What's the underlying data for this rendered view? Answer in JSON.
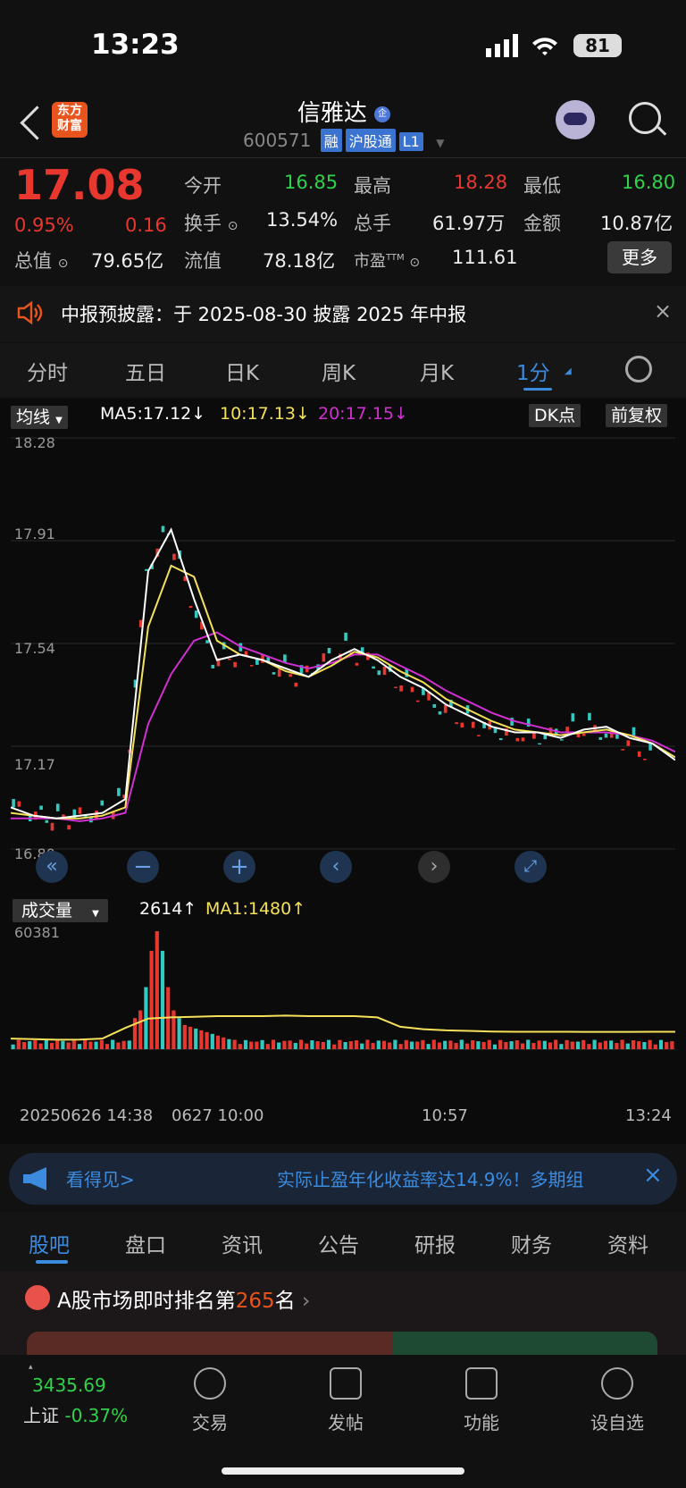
{
  "status_bar": {
    "time": "13:23",
    "battery": "81"
  },
  "header": {
    "back_icon": "chevron-left-icon",
    "app_logo": "东方财富",
    "stock_name": "信雅达",
    "enterprise_badge": "企",
    "stock_code": "600571",
    "tags": [
      "融",
      "沪股通",
      "L1"
    ]
  },
  "quote": {
    "price": "17.08",
    "change_pct": "0.95%",
    "change": "0.16",
    "open_label": "今开",
    "open": "16.85",
    "high_label": "最高",
    "high": "18.28",
    "low_label": "最低",
    "low": "16.80",
    "turnover_label": "换手",
    "turnover": "13.54%",
    "volume_label": "总手",
    "volume": "61.97万",
    "amount_label": "金额",
    "amount": "10.87亿",
    "mktcap_label": "总值",
    "mktcap": "79.65亿",
    "float_label": "流值",
    "float": "78.18亿",
    "pe_label": "市盈",
    "pe_sup": "TTM",
    "pe": "111.61",
    "more_button": "更多"
  },
  "notice": {
    "text": "中报预披露：于 2025-08-30 披露 2025 年中报",
    "close": "×"
  },
  "chart_tabs": [
    "分时",
    "五日",
    "日K",
    "周K",
    "月K",
    "1分"
  ],
  "active_tab": "1分",
  "indicator_bar": {
    "selector": "均线",
    "ma5": "MA5:17.12↓",
    "ma10": "10:17.13↓",
    "ma20": "20:17.15↓",
    "dk_button": "DK点",
    "adjust_button": "前复权"
  },
  "price_axis": [
    "18.28",
    "17.91",
    "17.54",
    "17.17",
    "16.80"
  ],
  "volume_bar": {
    "selector": "成交量",
    "current": "2614↑",
    "ma1": "MA1:1480↑",
    "max_label": "60381"
  },
  "time_axis": [
    "20250626 14:38",
    "0627 10:00",
    "10:57",
    "13:24"
  ],
  "ad_banner": {
    "left": "看得见>",
    "text": "实际止盈年化收益率达14.9%！多期组",
    "close": "×"
  },
  "bottom_tabs": [
    "股吧",
    "盘口",
    "资讯",
    "公告",
    "研报",
    "财务",
    "资料"
  ],
  "active_bottom_tab": "股吧",
  "ranking": {
    "prefix": "A股市场即时排名第",
    "rank": "265",
    "suffix": "名"
  },
  "bottom_nav": {
    "index_value": "3435.69",
    "index_label": "上证",
    "index_change": "-0.37%",
    "items": [
      "交易",
      "发帖",
      "功能",
      "设自选"
    ]
  },
  "colors": {
    "up": "#e8372f",
    "down": "#2fd24a",
    "accent": "#3b8bdf",
    "ma5": "#ffffff",
    "ma10": "#f5e05a",
    "ma20": "#d030d0"
  },
  "chart_data": {
    "type": "candlestick",
    "price_range": [
      16.8,
      18.28
    ],
    "volume_max": 60381,
    "ma5_close": [
      16.95,
      16.92,
      16.91,
      16.92,
      16.93,
      16.98,
      17.8,
      17.95,
      17.7,
      17.48,
      17.5,
      17.48,
      17.45,
      17.42,
      17.48,
      17.52,
      17.48,
      17.42,
      17.38,
      17.32,
      17.28,
      17.24,
      17.22,
      17.22,
      17.2,
      17.23,
      17.24,
      17.2,
      17.18,
      17.12
    ],
    "ma10_close": [
      16.93,
      16.92,
      16.91,
      16.91,
      16.92,
      16.95,
      17.6,
      17.82,
      17.78,
      17.55,
      17.5,
      17.48,
      17.44,
      17.42,
      17.46,
      17.51,
      17.49,
      17.44,
      17.4,
      17.34,
      17.3,
      17.26,
      17.23,
      17.22,
      17.21,
      17.22,
      17.23,
      17.21,
      17.18,
      17.13
    ],
    "ma20_close": [
      16.91,
      16.91,
      16.91,
      16.9,
      16.91,
      16.93,
      17.25,
      17.43,
      17.55,
      17.58,
      17.53,
      17.5,
      17.47,
      17.45,
      17.47,
      17.5,
      17.5,
      17.46,
      17.42,
      17.37,
      17.33,
      17.29,
      17.26,
      17.24,
      17.22,
      17.22,
      17.22,
      17.21,
      17.19,
      17.15
    ],
    "volume_ma1": [
      900,
      850,
      800,
      820,
      900,
      1800,
      2600,
      2700,
      2750,
      2800,
      2800,
      2800,
      2850,
      2800,
      2800,
      2800,
      2700,
      1900,
      1700,
      1600,
      1550,
      1500,
      1480,
      1480,
      1480,
      1470,
      1470,
      1470,
      1480,
      1480
    ]
  }
}
